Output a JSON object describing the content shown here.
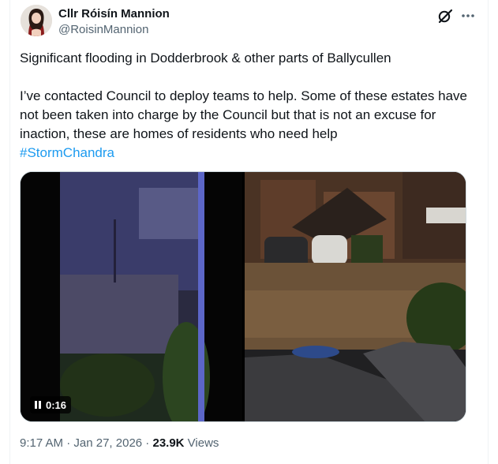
{
  "author": {
    "name": "Cllr Róisín Mannion",
    "handle": "@RoisinMannion"
  },
  "tweet": {
    "line1": "Significant flooding in Dodderbrook & other parts of Ballycullen",
    "line2": "I’ve contacted Council to deploy teams to help. Some of these estates have not been taken into charge by the Council but that is not an excuse for inaction, these are homes of residents who need help",
    "hashtag": "#StormChandra"
  },
  "media": {
    "video_duration": "0:16"
  },
  "meta": {
    "time": "9:17 AM",
    "separator1": " · ",
    "date": "Jan 27, 2026",
    "separator2": " · ",
    "views_count": "23.9K",
    "views_label": " Views"
  },
  "icons": {
    "grok": "grok-icon",
    "more": "more-icon",
    "pause": "pause-icon"
  },
  "colors": {
    "link": "#1d9bf0",
    "secondary_text": "#536471",
    "primary_text": "#0f1419"
  }
}
